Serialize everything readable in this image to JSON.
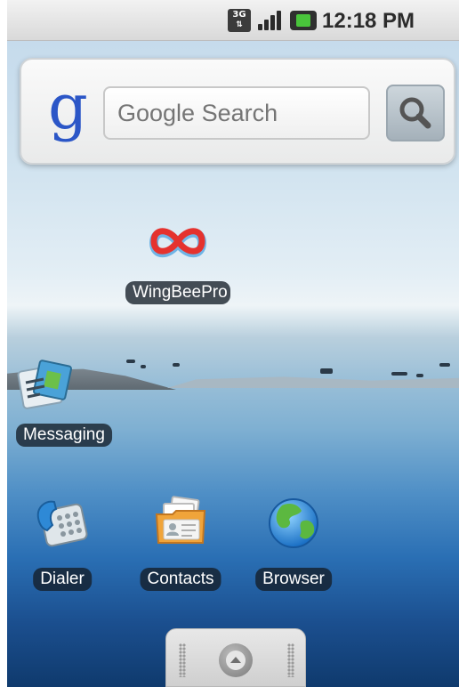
{
  "status_bar": {
    "network_label": "3G",
    "time": "12:18 PM",
    "icons": [
      "3g-data-icon",
      "signal-strength-icon",
      "battery-charging-icon"
    ]
  },
  "search_widget": {
    "logo_letter": "g",
    "placeholder": "Google Search"
  },
  "apps": {
    "wingbee": {
      "label": "WingBeePro",
      "icon": "infinity-logo-icon"
    },
    "messaging": {
      "label": "Messaging",
      "icon": "messaging-icon"
    },
    "dialer": {
      "label": "Dialer",
      "icon": "phone-icon"
    },
    "contacts": {
      "label": "Contacts",
      "icon": "contacts-folder-icon"
    },
    "browser": {
      "label": "Browser",
      "icon": "globe-icon"
    }
  },
  "colors": {
    "status_bar_bg": "#e2e2e2",
    "label_bg": "#1e2a34",
    "google_blue": "#2b56c7"
  }
}
